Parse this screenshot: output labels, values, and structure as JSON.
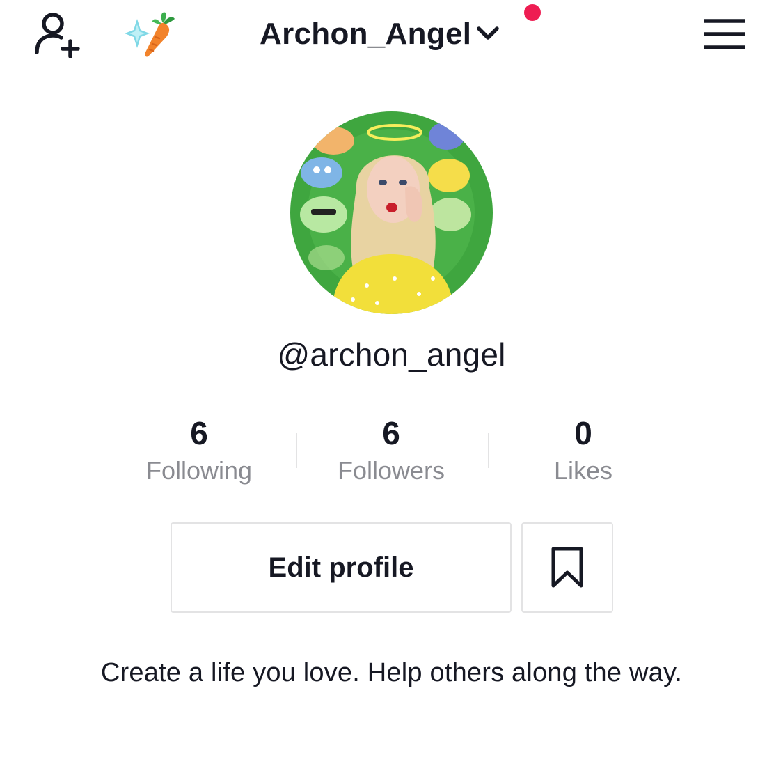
{
  "header": {
    "username_title": "Archon_Angel",
    "add_friend_icon": "person-add-icon",
    "badge_emoji": "✨🥕",
    "chevron_icon": "chevron-down-icon",
    "menu_icon": "hamburger-menu-icon"
  },
  "colors": {
    "notification_dot": "#ee1d52",
    "text_primary": "#161823",
    "text_secondary": "#8a8b91",
    "border": "#e3e3e4",
    "avatar_background": "#3fa63f"
  },
  "profile": {
    "handle": "@archon_angel",
    "bio": "Create a life you love.  Help others along the way."
  },
  "stats": [
    {
      "value": "6",
      "label": "Following"
    },
    {
      "value": "6",
      "label": "Followers"
    },
    {
      "value": "0",
      "label": "Likes"
    }
  ],
  "actions": {
    "edit_profile_label": "Edit profile",
    "favorites_icon": "bookmark-icon"
  }
}
